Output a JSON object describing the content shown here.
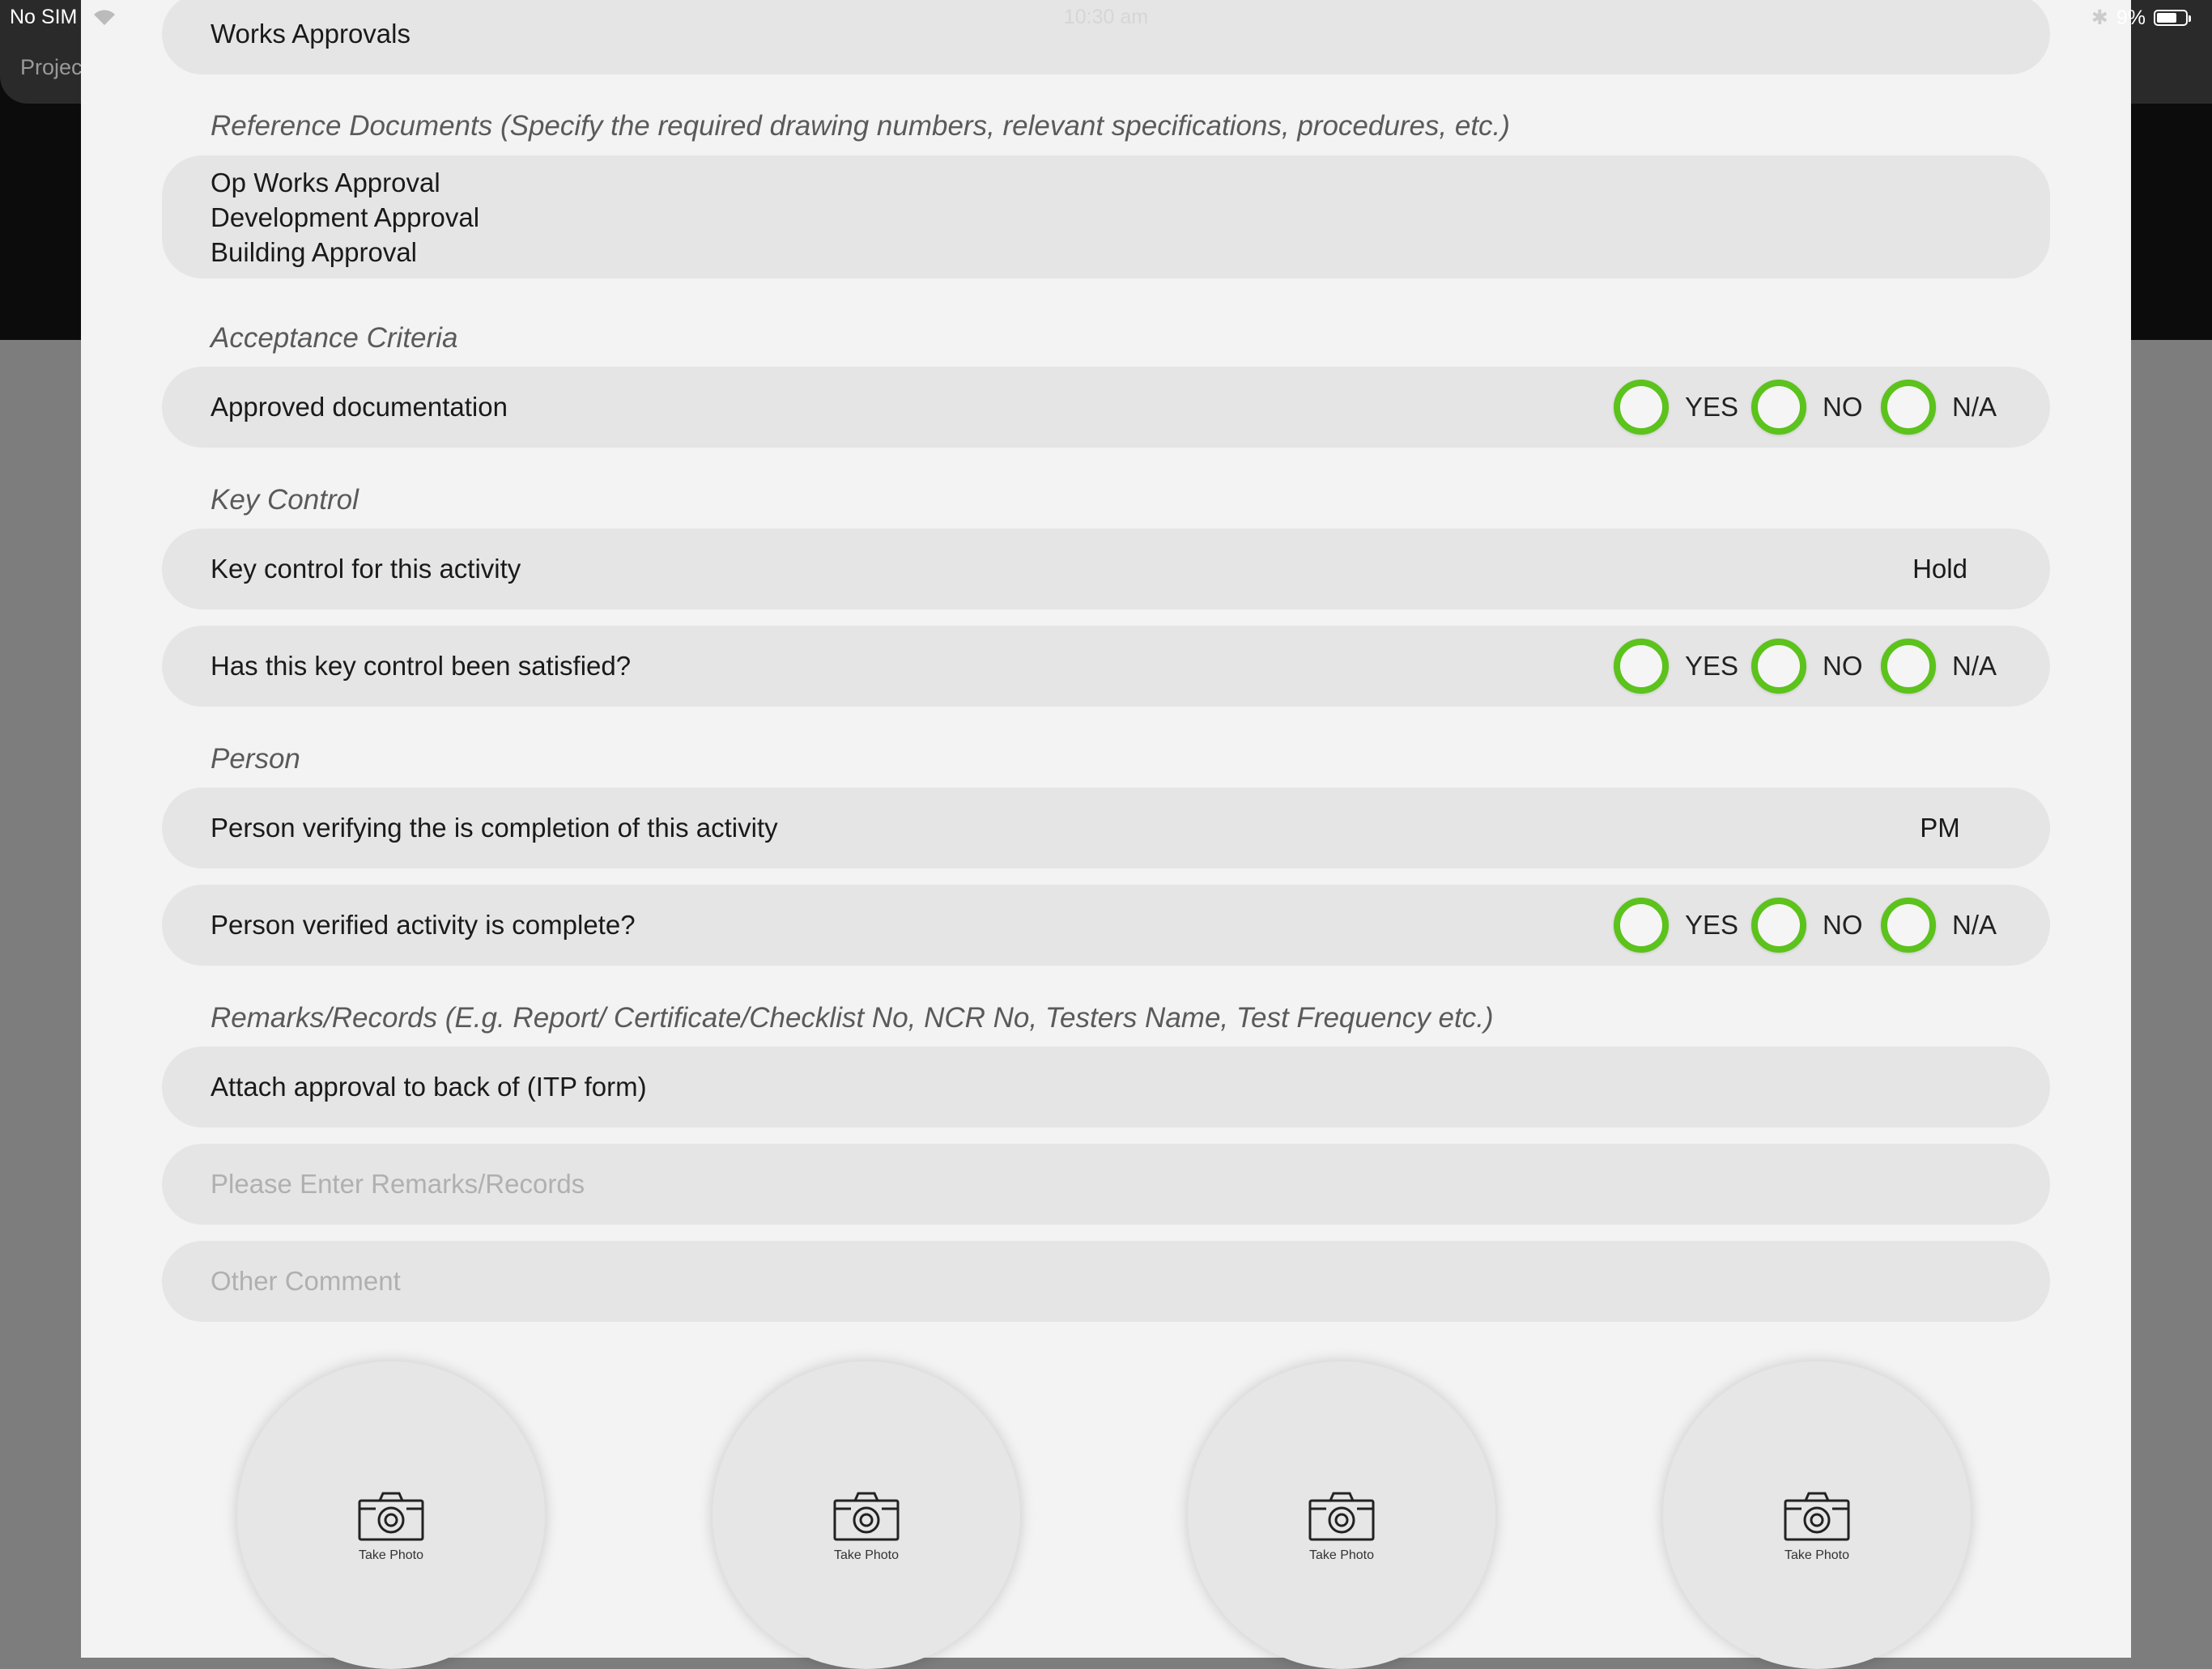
{
  "status": {
    "carrier": "No SIM",
    "time": "10:30 am",
    "battery": "9%"
  },
  "background": {
    "nav_title": "Projec"
  },
  "form": {
    "top_field": "Works Approvals",
    "reference": {
      "label": "Reference Documents (Specify the required drawing numbers, relevant specifications, procedures, etc.)",
      "lines": [
        "Op Works Approval",
        "Development Approval",
        "Building Approval"
      ]
    },
    "acceptance": {
      "label": "Acceptance Criteria",
      "question": "Approved documentation"
    },
    "key_control": {
      "label": "Key Control",
      "field_label": "Key control for this activity",
      "field_value": "Hold",
      "question": "Has this key control been satisfied?"
    },
    "person": {
      "label": "Person",
      "field_label": "Person verifying the is completion of this activity",
      "field_value": "PM",
      "question": "Person verified activity is complete?"
    },
    "remarks": {
      "label": "Remarks/Records (E.g. Report/ Certificate/Checklist No, NCR No, Testers Name, Test Frequency etc.)",
      "value": "Attach approval to back of (ITP form)",
      "placeholder": "Please Enter Remarks/Records",
      "comment_placeholder": "Other Comment"
    },
    "options": {
      "yes": "YES",
      "no": "NO",
      "na": "N/A"
    },
    "photo_label": "Take Photo"
  },
  "colors": {
    "radio_accent": "#5cc21c",
    "field_bg": "#e5e5e5",
    "sheet_bg": "#f3f3f3"
  }
}
